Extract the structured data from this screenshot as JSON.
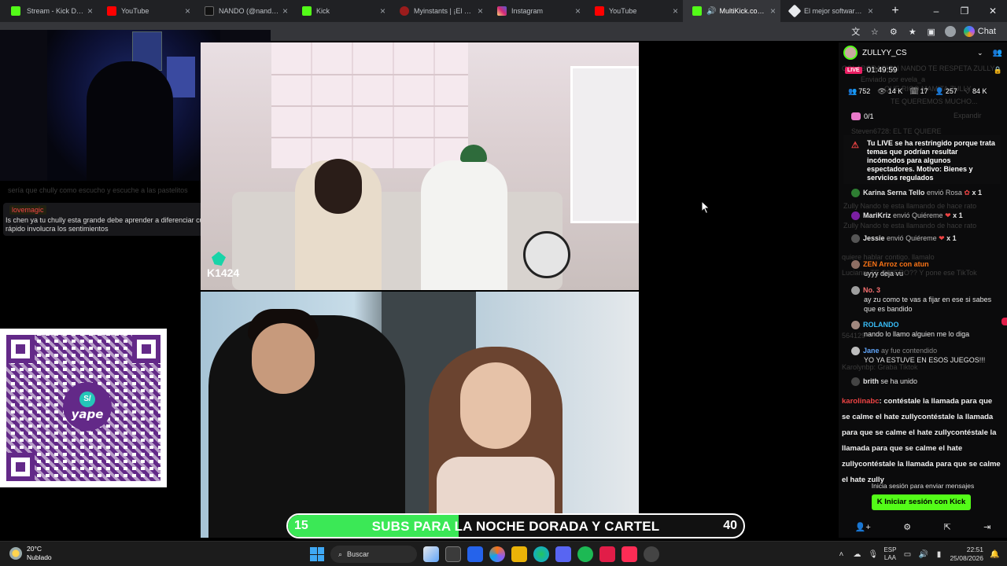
{
  "browser": {
    "tabs": [
      {
        "title": "Stream - Kick Dashboard",
        "favicon_color": "#53fc18"
      },
      {
        "title": "YouTube",
        "favicon_color": "#ff0000"
      },
      {
        "title": "NANDO (@nandoweec",
        "favicon_color": "#000000"
      },
      {
        "title": "Kick",
        "favicon_color": "#53fc18"
      },
      {
        "title": "Myinstants | ¡El sitio we",
        "favicon_color": "#9b1c1c"
      },
      {
        "title": "Instagram",
        "favicon_color": "#d62976"
      },
      {
        "title": "YouTube",
        "favicon_color": "#ff0000"
      },
      {
        "title": "MultiKick.com: Wat",
        "favicon_color": "#53fc18",
        "active": true
      },
      {
        "title": "El mejor software para",
        "favicon_color": "#e8eaed"
      }
    ],
    "new_tab": "+",
    "window_controls": [
      "–",
      "❐",
      "✕"
    ],
    "toolbar_chat_label": "Chat"
  },
  "left_chat": {
    "faded_line": "sería que chully como escucho y escuche a las pastelitos",
    "username": "lovemagic",
    "message": "Is chen ya tu chully esta grande debe aprender a diferenciar cuando es show muy rápido involucra los sentimientos"
  },
  "video_top": {
    "watermark": "K1424"
  },
  "subgoal": {
    "current": "15",
    "label": "SUBS PARA LA NOCHE DORADA Y CARTEL",
    "target": "40",
    "progress": 0.375,
    "fill_color": "#3be856"
  },
  "qr": {
    "brand": "yape",
    "brand_mark": "S/",
    "color": "#5b1e82"
  },
  "right_chat": {
    "channel": "ZULLYY_CS",
    "live_badge": "LIVE",
    "uptime": "01:49:59",
    "stats": [
      {
        "icon": "👥",
        "value": "752"
      },
      {
        "icon": "👁",
        "value": "14 K"
      },
      {
        "icon": "🗓",
        "value": "17"
      },
      {
        "icon": "👤",
        "value": "257"
      },
      {
        "icon": "♡",
        "value": "84 K"
      }
    ],
    "gift_counter": "0/1",
    "warning": "Tu LIVE se ha restringido porque trata temas que podrían resultar incómodos para algunos espectadores. Motivo: Bienes y servicios regulados",
    "faded_lines": [
      "COLABORACION NANDO TE RESPETA ZULLY",
      "Enviado por  evela_a",
      "QUE RICO MAMITA ZULLY",
      "TE QUEREMOS MUCHO...",
      "Expandir",
      "Steven6728: EL TE QUIERE",
      "Zully Nando te esta llamando de hace rato",
      "Zully Nando te esta llamando de hace rato",
      "quiere hablar contigo. llamalo",
      "Luciana: TE QUIERO?? Y pone ese TikTok",
      "564129",
      "Karolynbp:  Graba Tiktok"
    ],
    "messages": [
      {
        "user": "Karina Serna Tello",
        "gift": "envió Rosa",
        "count": "x 1"
      },
      {
        "user": "MariKriz",
        "gift": "envió Quiéreme",
        "count": "x 1"
      },
      {
        "user": "Jessie",
        "gift": "envió Quiéreme",
        "count": "x 1"
      },
      {
        "user": "ZEN Arroz con atun",
        "text": "uyyy deja vu"
      },
      {
        "user": "No. 3",
        "text": "ay zu como te vas a fijar en ese si sabes que es bandido"
      },
      {
        "user": "ROLANDO",
        "text": "nando lo llamo alguien me lo diga"
      },
      {
        "user": "Jane",
        "text": "ay fue contendido"
      },
      {
        "user": "",
        "text": "YO YA ESTUVE EN ESOS JUEGOS!!!"
      },
      {
        "user": "brith",
        "text": "se ha unido"
      }
    ],
    "long_message_user": "karolinabc",
    "long_message": "contéstale la llamada para que se calme el hate zullycontéstale la llamada para que se calme el hate zullycontéstale la llamada para que se calme el hate zullycontéstale la llamada para que se calme el hate zully",
    "login_hint": "Inicia sesión para enviar mensajes",
    "login_button": "Iniciar sesión con Kick"
  },
  "taskbar": {
    "temperature": "20°C",
    "weather": "Nublado",
    "search_placeholder": "Buscar",
    "lang_top": "ESP",
    "lang_bottom": "LAA",
    "time": "22:51",
    "date": "25/08/2026"
  }
}
